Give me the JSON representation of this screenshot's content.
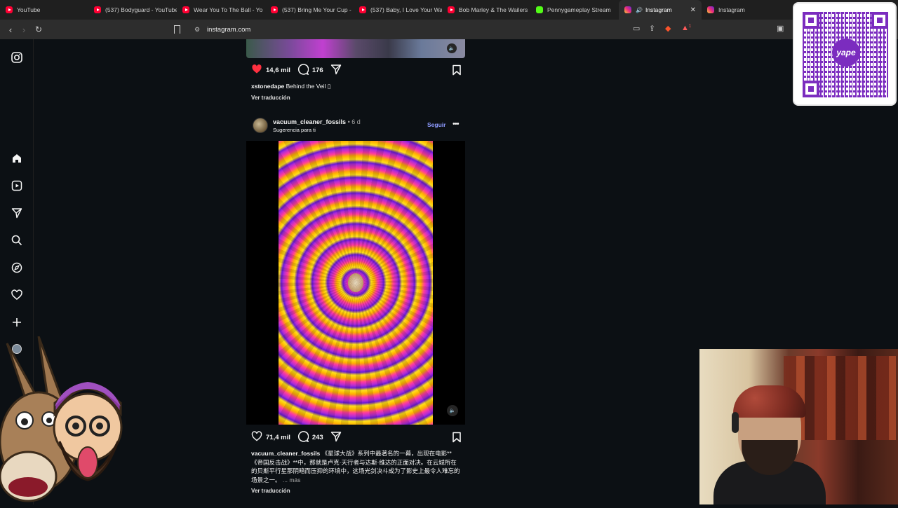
{
  "browser": {
    "tabs": [
      {
        "label": "YouTube",
        "icon": "youtube-icon"
      },
      {
        "label": "(537) Bodyguard - YouTube",
        "icon": "youtube-icon"
      },
      {
        "label": "Wear You To The Ball - Yo",
        "icon": "youtube-icon"
      },
      {
        "label": "(537) Bring Me Your Cup -",
        "icon": "youtube-icon"
      },
      {
        "label": "(537) Baby, I Love Your Wa",
        "icon": "youtube-icon"
      },
      {
        "label": "Bob Marley & The Wailers",
        "icon": "youtube-icon"
      },
      {
        "label": "Pennygameplay Stream",
        "icon": "kick-icon"
      },
      {
        "label": "Instagram",
        "icon": "instagram-icon",
        "active": true
      },
      {
        "label": "Instagram",
        "icon": "instagram-icon"
      }
    ],
    "url": "instagram.com",
    "notification_count": "1"
  },
  "post1": {
    "likes": "14,6 mil",
    "comments": "176",
    "caption_user": "xstonedape",
    "caption_text": "Behind the Veil ▯",
    "see_translation": "Ver traducción"
  },
  "post2": {
    "username": "vacuum_cleaner_fossils",
    "time": "• 6 d",
    "subtitle": "Sugerencia para ti",
    "follow_label": "Seguir",
    "likes": "71,4 mil",
    "comments": "243",
    "caption_user": "vacuum_cleaner_fossils",
    "caption_text": "《星球大战》系列中最著名的一幕，出现在电影**《帝国反击战》**中，那就是卢克·天行者与达斯·维达的正面对决。在云城所在的贝斯平行星那阴暗而压抑的环境中，这场光剑决斗成为了影史上最令人难忘的场景之一。",
    "more": "... más",
    "see_translation": "Ver traducción"
  },
  "overlay": {
    "qr_brand": "yape"
  },
  "colors": {
    "accent_follow": "#8e9bff",
    "like_red": "#ff3040",
    "brand_purple": "#7b2cbf"
  }
}
